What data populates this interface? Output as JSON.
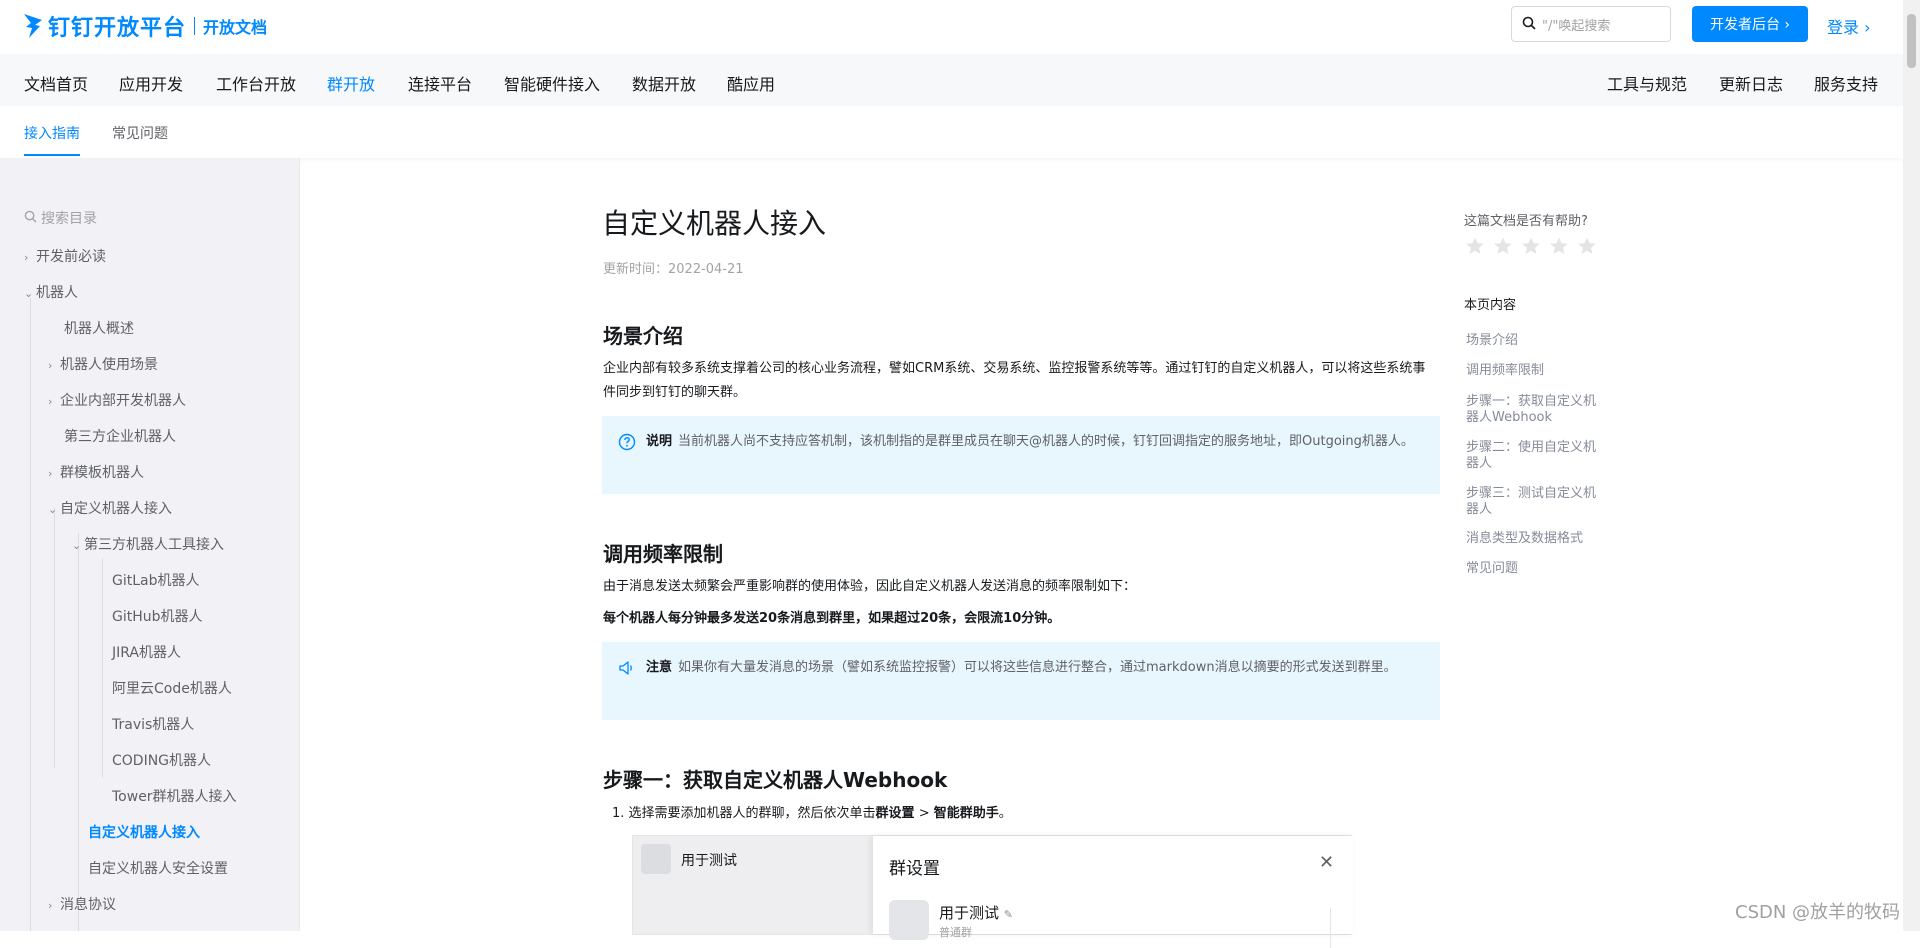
{
  "header": {
    "brand": "钉钉开放平台",
    "sub": "开放文档",
    "search_placeholder": "\"/\"唤起搜索",
    "dev_button": "开发者后台 ›",
    "login": "登录 ›"
  },
  "mainnav": {
    "left": [
      "文档首页",
      "应用开发",
      "工作台开放",
      "群开放",
      "连接平台",
      "智能硬件接入",
      "数据开放",
      "酷应用"
    ],
    "active": "群开放",
    "right": [
      "工具与规范",
      "更新日志",
      "服务支持"
    ]
  },
  "subnav": {
    "items": [
      "接入指南",
      "常见问题"
    ],
    "active": "接入指南"
  },
  "sidebar": {
    "search_placeholder": "搜索目录",
    "items": [
      "开发前必读",
      "机器人",
      "机器人概述",
      "机器人使用场景",
      "企业内部开发机器人",
      "第三方企业机器人",
      "群模板机器人",
      "自定义机器人接入",
      "第三方机器人工具接入",
      "GitLab机器人",
      "GitHub机器人",
      "JIRA机器人",
      "阿里云Code机器人",
      "Travis机器人",
      "CODING机器人",
      "Tower群机器人接入",
      "自定义机器人接入",
      "自定义机器人安全设置",
      "消息协议"
    ]
  },
  "doc": {
    "title": "自定义机器人接入",
    "updated": "更新时间：2022-04-21",
    "s1_title": "场景介绍",
    "s1_para": "企业内部有较多系统支撑着公司的核心业务流程，譬如CRM系统、交易系统、监控报警系统等等。通过钉钉的自定义机器人，可以将这些系统事件同步到钉钉的聊天群。",
    "note1_label": "说明",
    "note1_text": "当前机器人尚不支持应答机制，该机制指的是群里成员在聊天@机器人的时候，钉钉回调指定的服务地址，即Outgoing机器人。",
    "s2_title": "调用频率限制",
    "s2_para": "由于消息发送太频繁会严重影响群的使用体验，因此自定义机器人发送消息的频率限制如下：",
    "s2_bold": "每个机器人每分钟最多发送20条消息到群里，如果超过20条，会限流10分钟。",
    "note2_label": "注意",
    "note2_text": "如果你有大量发消息的场景（譬如系统监控报警）可以将这些信息进行整合，通过markdown消息以摘要的形式发送到群里。",
    "s3_title": "步骤一：获取自定义机器人Webhook",
    "step1_prefix": "1. 选择需要添加机器人的群聊，然后依次单击",
    "step1_b1": "群设置",
    "step1_mid": " > ",
    "step1_b2": "智能群助手",
    "step1_end": "。",
    "shot_group": "用于测试",
    "shot_panel_title": "群设置",
    "shot_group2": "用于测试",
    "shot_small": "普通群"
  },
  "rail": {
    "helpful": "这篇文档是否有帮助?",
    "rating": {
      "value": 0,
      "max": 5
    },
    "toc_title": "本页内容",
    "toc": [
      "场景介绍",
      "调用频率限制",
      "步骤一：获取自定义机器人Webhook",
      "步骤二：使用自定义机器人",
      "步骤三：测试自定义机器人",
      "消息类型及数据格式",
      "常见问题"
    ]
  },
  "watermark": "CSDN @放羊的牧码",
  "colors": {
    "accent": "#0089ff",
    "note_bg": "#e8f6fe",
    "sidebar_bg": "#f2f2f6"
  }
}
